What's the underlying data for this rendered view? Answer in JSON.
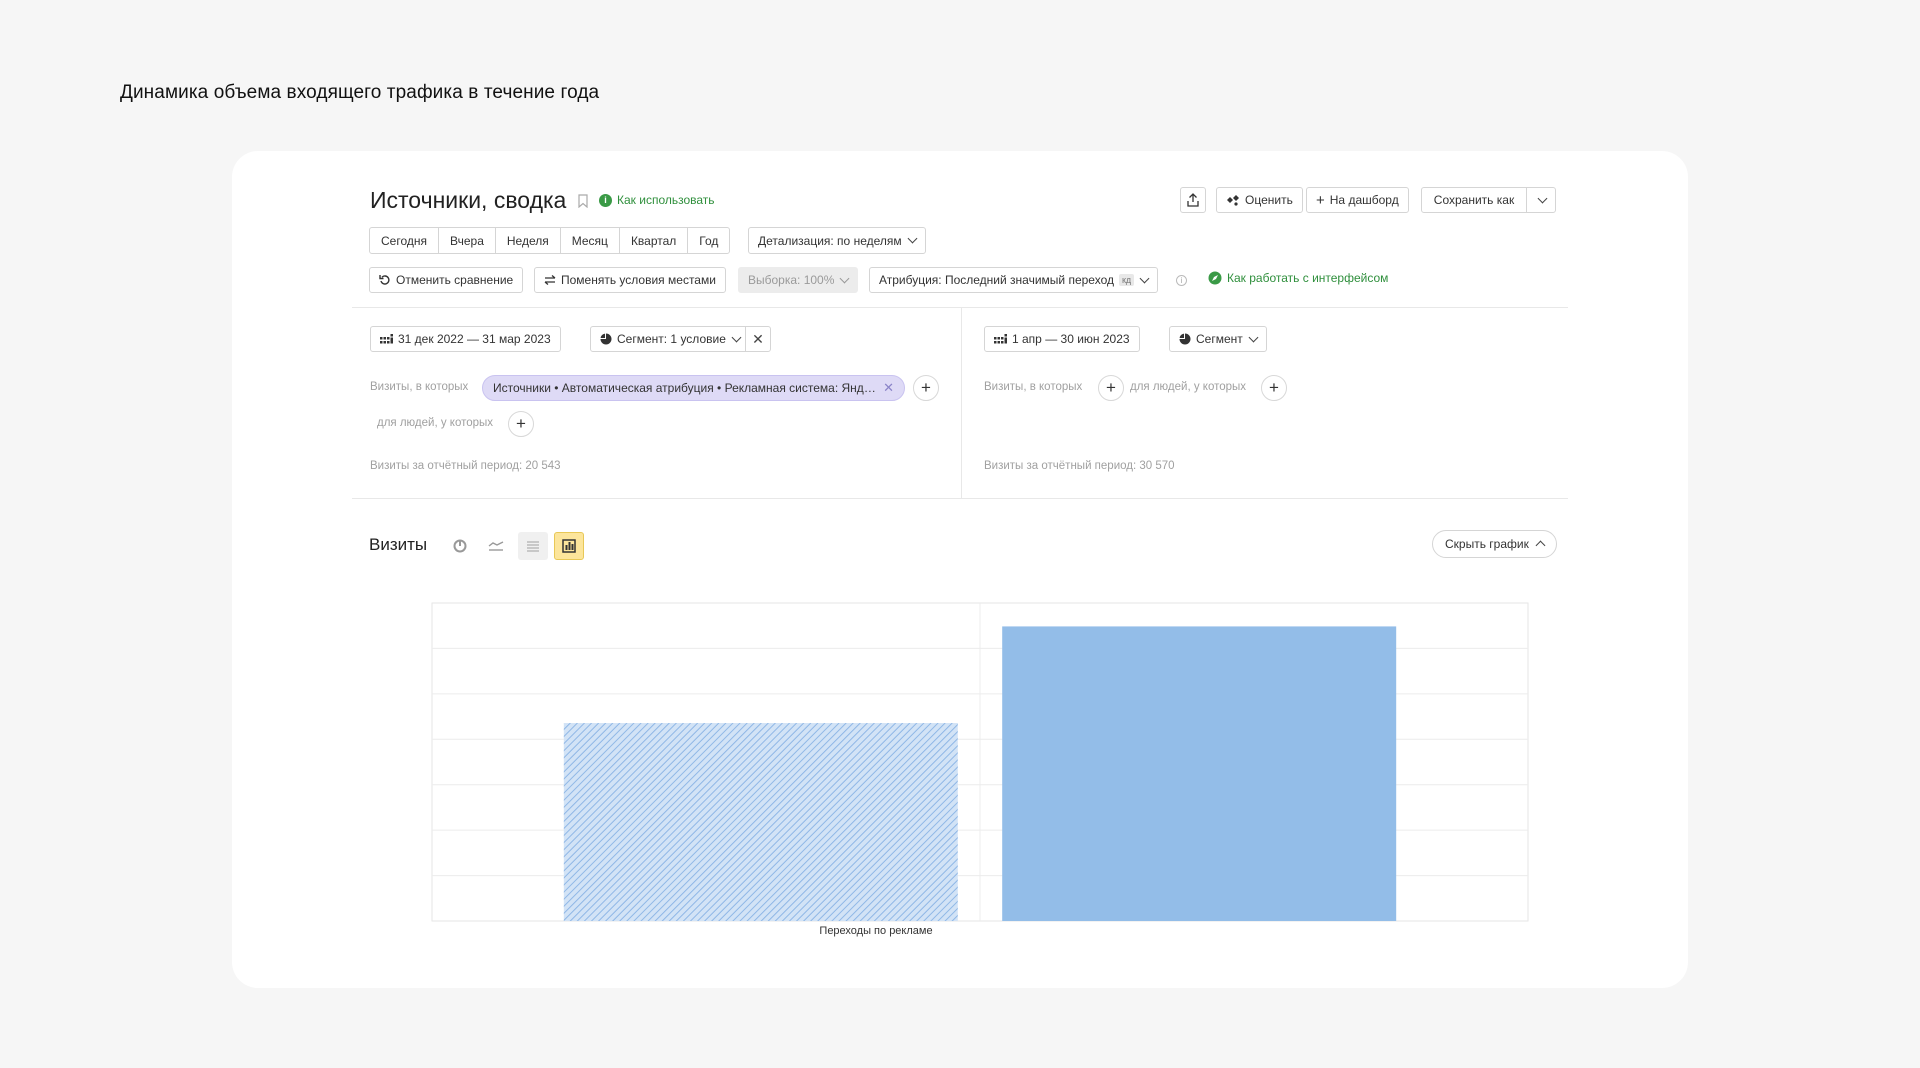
{
  "page_heading": "Динамика объема входящего трафика в течение года",
  "header": {
    "title": "Источники, сводка",
    "howto_link": "Как использовать",
    "toolbar": {
      "rate_label": "Оценить",
      "dashboard_label": "На дашборд",
      "save_as_label": "Сохранить как"
    }
  },
  "periods": [
    "Сегодня",
    "Вчера",
    "Неделя",
    "Месяц",
    "Квартал",
    "Год"
  ],
  "detail_label": "Детализация: по неделям",
  "actions": {
    "cancel_compare": "Отменить сравнение",
    "swap_conditions": "Поменять условия местами",
    "sampling": "Выборка: 100%",
    "attribution": "Атрибуция: Последний значимый переход",
    "attribution_badge": "кд",
    "interface_help": "Как работать с интерфейсом"
  },
  "segment_a": {
    "date_range": "31 дек 2022 — 31 мар 2023",
    "segment_label": "Сегмент: 1 условие",
    "visits_where": "Визиты, в которых",
    "condition_chip": "Источники • Автоматическая атрибуция • Рекламная система: Янде...",
    "people_where": "для людей, у которых",
    "total_visits": "Визиты за отчётный период: 20 543"
  },
  "segment_b": {
    "date_range": "1 апр — 30 июн 2023",
    "segment_label": "Сегмент",
    "visits_where": "Визиты, в которых",
    "people_where": "для людей, у которых",
    "total_visits": "Визиты за отчётный период: 30 570"
  },
  "chart_section": {
    "title": "Визиты",
    "hide_chart": "Скрыть график"
  },
  "colors": {
    "accent_green": "#2f8f3c",
    "bar_fill": "#93bde8",
    "chip_bg": "#dedaf6",
    "active_toggle": "#fce59b"
  },
  "chart_data": {
    "type": "bar",
    "categories": [
      "Переходы по рекламе"
    ],
    "series": [
      {
        "values": [
          20543
        ]
      },
      {
        "values": [
          30570
        ]
      }
    ],
    "ylim": [
      0,
      33000
    ],
    "grid": true,
    "legend": "none"
  }
}
